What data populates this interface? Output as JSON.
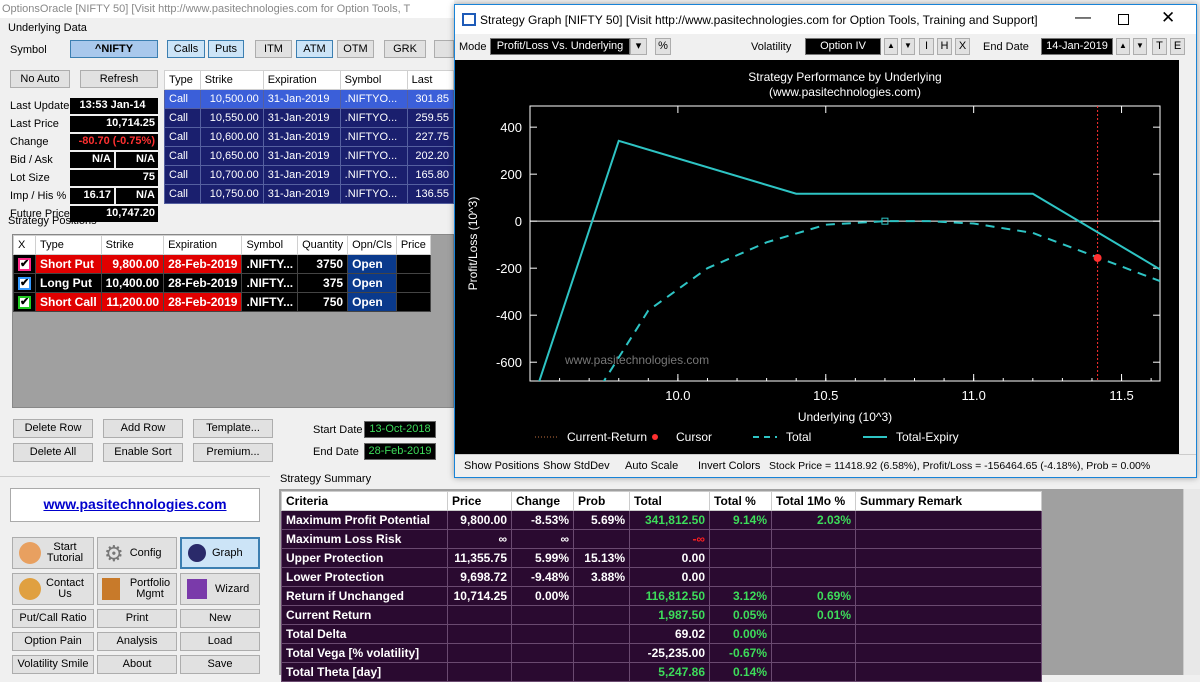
{
  "main": {
    "title": "OptionsOracle [NIFTY 50]    [Visit  http://www.pasitechnologies.com  for Option Tools, T"
  },
  "underlying": {
    "section": "Underlying Data",
    "symbol_label": "Symbol",
    "symbol_value": "^NIFTY",
    "calls": "Calls",
    "puts": "Puts",
    "itm": "ITM",
    "atm": "ATM",
    "otm": "OTM",
    "grk": "GRK",
    "no_auto": "No Auto",
    "refresh": "Refresh",
    "fields": [
      {
        "label": "Last Update",
        "value": "13:53 Jan-14"
      },
      {
        "label": "Last Price",
        "value": "10,714.25"
      },
      {
        "label": "Change",
        "value": "-80.70 (-0.75%)"
      },
      {
        "label": "Bid / Ask",
        "value": "N/A",
        "value2": "N/A"
      },
      {
        "label": "Lot Size",
        "value": "75"
      },
      {
        "label": "Imp / His %",
        "value": "16.17",
        "value2": "N/A"
      },
      {
        "label": "Future Price",
        "value": "10,747.20"
      }
    ]
  },
  "options": {
    "headers": [
      "Type",
      "Strike",
      "Expiration",
      "Symbol",
      "Last"
    ],
    "rows": [
      [
        "Call",
        "10,500.00",
        "31-Jan-2019",
        ".NIFTYO...",
        "301.85"
      ],
      [
        "Call",
        "10,550.00",
        "31-Jan-2019",
        ".NIFTYO...",
        "259.55"
      ],
      [
        "Call",
        "10,600.00",
        "31-Jan-2019",
        ".NIFTYO...",
        "227.75"
      ],
      [
        "Call",
        "10,650.00",
        "31-Jan-2019",
        ".NIFTYO...",
        "202.20"
      ],
      [
        "Call",
        "10,700.00",
        "31-Jan-2019",
        ".NIFTYO...",
        "165.80"
      ],
      [
        "Call",
        "10,750.00",
        "31-Jan-2019",
        ".NIFTYO...",
        "136.55"
      ]
    ]
  },
  "positions": {
    "section": "Strategy Positions",
    "headers": [
      "X",
      "Type",
      "Strike",
      "Expiration",
      "Symbol",
      "Quantity",
      "Opn/Cls",
      "Price"
    ],
    "rows": [
      {
        "type": "Short Put",
        "strike": "9,800.00",
        "exp": "28-Feb-2019",
        "symbol": ".NIFTY...",
        "qty": "3750",
        "oc": "Open",
        "cb": "#ff2a8a",
        "color": "red"
      },
      {
        "type": "Long Put",
        "strike": "10,400.00",
        "exp": "28-Feb-2019",
        "symbol": ".NIFTY...",
        "qty": "375",
        "oc": "Open",
        "cb": "#3399ff",
        "color": "black"
      },
      {
        "type": "Short Call",
        "strike": "11,200.00",
        "exp": "28-Feb-2019",
        "symbol": ".NIFTY...",
        "qty": "750",
        "oc": "Open",
        "cb": "#22cc22",
        "color": "red"
      }
    ]
  },
  "actions": {
    "delete_row": "Delete Row",
    "add_row": "Add Row",
    "template": "Template...",
    "delete_all": "Delete All",
    "enable_sort": "Enable Sort",
    "premium": "Premium...",
    "start_date_label": "Start Date",
    "start_date": "13-Oct-2018",
    "end_date_label": "End Date",
    "end_date": "28-Feb-2019"
  },
  "sidebar": {
    "link": "www.pasitechnologies.com",
    "buttons": [
      "Start Tutorial",
      "Config",
      "Graph",
      "Contact Us",
      "Portfolio Mgmt",
      "Wizard"
    ],
    "small": [
      "Put/Call Ratio",
      "Print",
      "New",
      "Option Pain",
      "Analysis",
      "Load",
      "Volatility Smile",
      "About",
      "Save"
    ]
  },
  "summary": {
    "section": "Strategy Summary",
    "headers": [
      "Criteria",
      "Price",
      "Change",
      "Prob",
      "Total",
      "Total %",
      "Total 1Mo %",
      "Summary Remark"
    ],
    "rows": [
      [
        "Maximum Profit Potential",
        "9,800.00",
        "-8.53%",
        "5.69%",
        "341,812.50",
        "9.14%",
        "2.03%",
        ""
      ],
      [
        "Maximum Loss Risk",
        "∞",
        "∞",
        "",
        "-∞",
        "",
        "",
        ""
      ],
      [
        "Upper Protection",
        "11,355.75",
        "5.99%",
        "15.13%",
        "0.00",
        "",
        "",
        ""
      ],
      [
        "Lower Protection",
        "9,698.72",
        "-9.48%",
        "3.88%",
        "0.00",
        "",
        "",
        ""
      ],
      [
        "Return if Unchanged",
        "10,714.25",
        "0.00%",
        "",
        "116,812.50",
        "3.12%",
        "0.69%",
        ""
      ],
      [
        "Current Return",
        "",
        "",
        "",
        "1,987.50",
        "0.05%",
        "0.01%",
        ""
      ],
      [
        "Total Delta",
        "",
        "",
        "",
        "69.02",
        "0.00%",
        "",
        ""
      ],
      [
        "Total Vega [% volatility]",
        "",
        "",
        "",
        "-25,235.00",
        "-0.67%",
        "",
        ""
      ],
      [
        "Total Theta [day]",
        "",
        "",
        "",
        "5,247.86",
        "0.14%",
        "",
        ""
      ]
    ]
  },
  "graph_window": {
    "title": "Strategy Graph [NIFTY 50]    [Visit  http://www.pasitechnologies.com  for Option Tools, Training and Support]",
    "mode_label": "Mode",
    "mode_value": "Profit/Loss Vs. Underlying",
    "pct": "%",
    "vol_label": "Volatility",
    "vol_value": "Option IV",
    "i": "I",
    "h": "H",
    "x": "X",
    "end_date_label": "End Date",
    "end_date": "14-Jan-2019",
    "t": "T",
    "e": "E",
    "bottom": {
      "show_positions": "Show Positions",
      "show_stddev": "Show StdDev",
      "auto_scale": "Auto Scale",
      "invert_colors": "Invert Colors",
      "status": "Stock Price = 11418.92 (6.58%), Profit/Loss = -156464.65 (-4.18%), Prob = 0.00%"
    }
  },
  "chart_data": {
    "type": "line",
    "title": "Strategy Performance by Underlying",
    "subtitle": "(www.pasitechnologies.com)",
    "xlabel": "Underlying (10^3)",
    "ylabel": "Profit/Loss (10^3)",
    "watermark": "www.pasitechnologies.com",
    "xlim": [
      9.5,
      11.63
    ],
    "ylim": [
      -680,
      490
    ],
    "xticks": [
      "10.0",
      "10.5",
      "11.0",
      "11.5"
    ],
    "yticks": [
      "400",
      "200",
      "0",
      "-200",
      "-400",
      "-600"
    ],
    "xtick_vals": [
      10.0,
      10.5,
      11.0,
      11.5
    ],
    "ytick_vals": [
      400,
      200,
      0,
      -200,
      -400,
      -600
    ],
    "colors": {
      "series": "#2ec4c4",
      "cursor": "#ff3030"
    },
    "legend": [
      "Current-Return",
      "Cursor",
      "Total",
      "Total-Expiry"
    ],
    "series": [
      {
        "name": "Total-Expiry",
        "style": "solid",
        "x": [
          9.5,
          9.8,
          10.4,
          11.2,
          11.63
        ],
        "y": [
          -800,
          341.8,
          116.8,
          116.8,
          -205
        ]
      },
      {
        "name": "Total",
        "style": "dashed",
        "x": [
          9.74,
          9.9,
          10.1,
          10.3,
          10.5,
          10.7,
          10.85,
          11.0,
          11.2,
          11.4,
          11.63
        ],
        "y": [
          -700,
          -380,
          -200,
          -90,
          -15,
          0,
          0,
          -10,
          -50,
          -145,
          -255
        ]
      }
    ],
    "cursor": {
      "x": 11.419,
      "y": -156.5
    },
    "marker": {
      "x": 10.7,
      "y": 0
    }
  }
}
